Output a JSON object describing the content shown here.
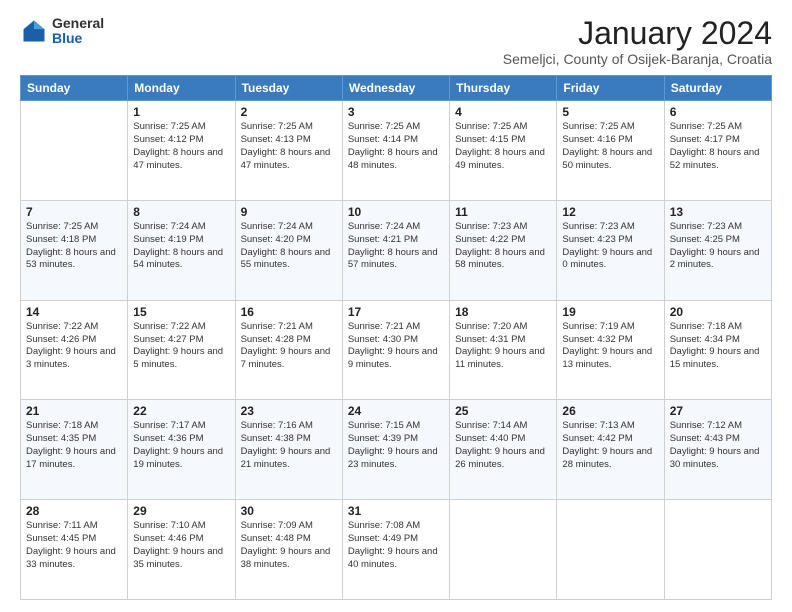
{
  "header": {
    "logo_general": "General",
    "logo_blue": "Blue",
    "month_title": "January 2024",
    "location": "Semeljci, County of Osijek-Baranja, Croatia"
  },
  "days_of_week": [
    "Sunday",
    "Monday",
    "Tuesday",
    "Wednesday",
    "Thursday",
    "Friday",
    "Saturday"
  ],
  "weeks": [
    [
      {
        "day": "",
        "sunrise": "",
        "sunset": "",
        "daylight": ""
      },
      {
        "day": "1",
        "sunrise": "Sunrise: 7:25 AM",
        "sunset": "Sunset: 4:12 PM",
        "daylight": "Daylight: 8 hours and 47 minutes."
      },
      {
        "day": "2",
        "sunrise": "Sunrise: 7:25 AM",
        "sunset": "Sunset: 4:13 PM",
        "daylight": "Daylight: 8 hours and 47 minutes."
      },
      {
        "day": "3",
        "sunrise": "Sunrise: 7:25 AM",
        "sunset": "Sunset: 4:14 PM",
        "daylight": "Daylight: 8 hours and 48 minutes."
      },
      {
        "day": "4",
        "sunrise": "Sunrise: 7:25 AM",
        "sunset": "Sunset: 4:15 PM",
        "daylight": "Daylight: 8 hours and 49 minutes."
      },
      {
        "day": "5",
        "sunrise": "Sunrise: 7:25 AM",
        "sunset": "Sunset: 4:16 PM",
        "daylight": "Daylight: 8 hours and 50 minutes."
      },
      {
        "day": "6",
        "sunrise": "Sunrise: 7:25 AM",
        "sunset": "Sunset: 4:17 PM",
        "daylight": "Daylight: 8 hours and 52 minutes."
      }
    ],
    [
      {
        "day": "7",
        "sunrise": "Sunrise: 7:25 AM",
        "sunset": "Sunset: 4:18 PM",
        "daylight": "Daylight: 8 hours and 53 minutes."
      },
      {
        "day": "8",
        "sunrise": "Sunrise: 7:24 AM",
        "sunset": "Sunset: 4:19 PM",
        "daylight": "Daylight: 8 hours and 54 minutes."
      },
      {
        "day": "9",
        "sunrise": "Sunrise: 7:24 AM",
        "sunset": "Sunset: 4:20 PM",
        "daylight": "Daylight: 8 hours and 55 minutes."
      },
      {
        "day": "10",
        "sunrise": "Sunrise: 7:24 AM",
        "sunset": "Sunset: 4:21 PM",
        "daylight": "Daylight: 8 hours and 57 minutes."
      },
      {
        "day": "11",
        "sunrise": "Sunrise: 7:23 AM",
        "sunset": "Sunset: 4:22 PM",
        "daylight": "Daylight: 8 hours and 58 minutes."
      },
      {
        "day": "12",
        "sunrise": "Sunrise: 7:23 AM",
        "sunset": "Sunset: 4:23 PM",
        "daylight": "Daylight: 9 hours and 0 minutes."
      },
      {
        "day": "13",
        "sunrise": "Sunrise: 7:23 AM",
        "sunset": "Sunset: 4:25 PM",
        "daylight": "Daylight: 9 hours and 2 minutes."
      }
    ],
    [
      {
        "day": "14",
        "sunrise": "Sunrise: 7:22 AM",
        "sunset": "Sunset: 4:26 PM",
        "daylight": "Daylight: 9 hours and 3 minutes."
      },
      {
        "day": "15",
        "sunrise": "Sunrise: 7:22 AM",
        "sunset": "Sunset: 4:27 PM",
        "daylight": "Daylight: 9 hours and 5 minutes."
      },
      {
        "day": "16",
        "sunrise": "Sunrise: 7:21 AM",
        "sunset": "Sunset: 4:28 PM",
        "daylight": "Daylight: 9 hours and 7 minutes."
      },
      {
        "day": "17",
        "sunrise": "Sunrise: 7:21 AM",
        "sunset": "Sunset: 4:30 PM",
        "daylight": "Daylight: 9 hours and 9 minutes."
      },
      {
        "day": "18",
        "sunrise": "Sunrise: 7:20 AM",
        "sunset": "Sunset: 4:31 PM",
        "daylight": "Daylight: 9 hours and 11 minutes."
      },
      {
        "day": "19",
        "sunrise": "Sunrise: 7:19 AM",
        "sunset": "Sunset: 4:32 PM",
        "daylight": "Daylight: 9 hours and 13 minutes."
      },
      {
        "day": "20",
        "sunrise": "Sunrise: 7:18 AM",
        "sunset": "Sunset: 4:34 PM",
        "daylight": "Daylight: 9 hours and 15 minutes."
      }
    ],
    [
      {
        "day": "21",
        "sunrise": "Sunrise: 7:18 AM",
        "sunset": "Sunset: 4:35 PM",
        "daylight": "Daylight: 9 hours and 17 minutes."
      },
      {
        "day": "22",
        "sunrise": "Sunrise: 7:17 AM",
        "sunset": "Sunset: 4:36 PM",
        "daylight": "Daylight: 9 hours and 19 minutes."
      },
      {
        "day": "23",
        "sunrise": "Sunrise: 7:16 AM",
        "sunset": "Sunset: 4:38 PM",
        "daylight": "Daylight: 9 hours and 21 minutes."
      },
      {
        "day": "24",
        "sunrise": "Sunrise: 7:15 AM",
        "sunset": "Sunset: 4:39 PM",
        "daylight": "Daylight: 9 hours and 23 minutes."
      },
      {
        "day": "25",
        "sunrise": "Sunrise: 7:14 AM",
        "sunset": "Sunset: 4:40 PM",
        "daylight": "Daylight: 9 hours and 26 minutes."
      },
      {
        "day": "26",
        "sunrise": "Sunrise: 7:13 AM",
        "sunset": "Sunset: 4:42 PM",
        "daylight": "Daylight: 9 hours and 28 minutes."
      },
      {
        "day": "27",
        "sunrise": "Sunrise: 7:12 AM",
        "sunset": "Sunset: 4:43 PM",
        "daylight": "Daylight: 9 hours and 30 minutes."
      }
    ],
    [
      {
        "day": "28",
        "sunrise": "Sunrise: 7:11 AM",
        "sunset": "Sunset: 4:45 PM",
        "daylight": "Daylight: 9 hours and 33 minutes."
      },
      {
        "day": "29",
        "sunrise": "Sunrise: 7:10 AM",
        "sunset": "Sunset: 4:46 PM",
        "daylight": "Daylight: 9 hours and 35 minutes."
      },
      {
        "day": "30",
        "sunrise": "Sunrise: 7:09 AM",
        "sunset": "Sunset: 4:48 PM",
        "daylight": "Daylight: 9 hours and 38 minutes."
      },
      {
        "day": "31",
        "sunrise": "Sunrise: 7:08 AM",
        "sunset": "Sunset: 4:49 PM",
        "daylight": "Daylight: 9 hours and 40 minutes."
      },
      {
        "day": "",
        "sunrise": "",
        "sunset": "",
        "daylight": ""
      },
      {
        "day": "",
        "sunrise": "",
        "sunset": "",
        "daylight": ""
      },
      {
        "day": "",
        "sunrise": "",
        "sunset": "",
        "daylight": ""
      }
    ]
  ]
}
